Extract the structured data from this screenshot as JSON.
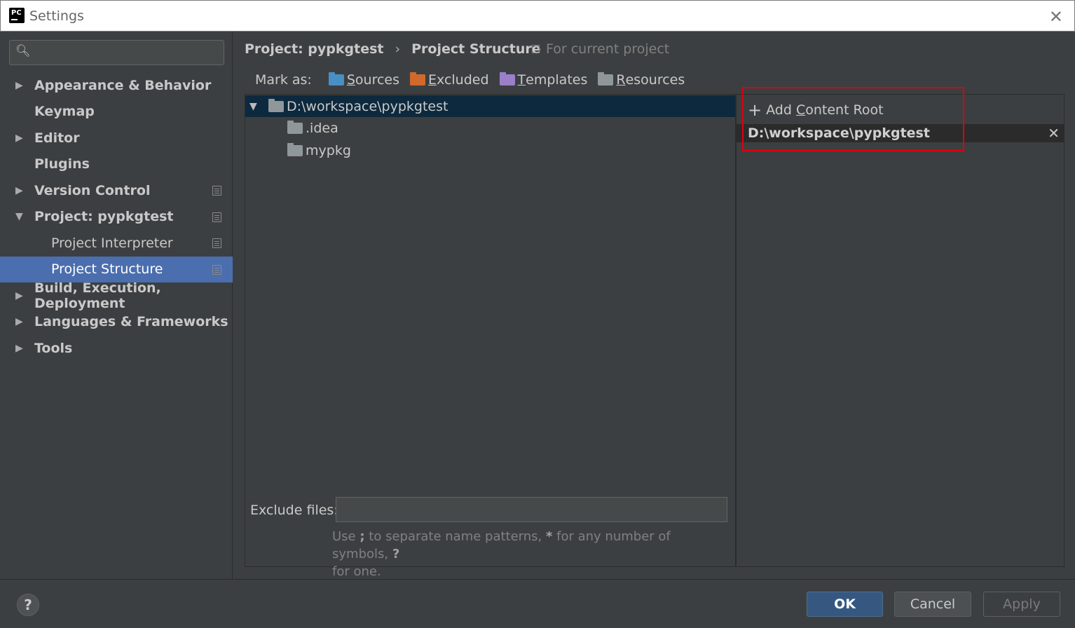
{
  "window": {
    "title": "Settings"
  },
  "sidebar": {
    "search": {
      "placeholder": ""
    },
    "items": [
      {
        "label": "Appearance & Behavior",
        "expandable": true
      },
      {
        "label": "Keymap",
        "expandable": false
      },
      {
        "label": "Editor",
        "expandable": true
      },
      {
        "label": "Plugins",
        "expandable": false
      },
      {
        "label": "Version Control",
        "expandable": true
      },
      {
        "label": "Project: pypkgtest",
        "expandable": true,
        "expanded": true
      },
      {
        "label": "Project Interpreter"
      },
      {
        "label": "Project Structure",
        "selected": true
      },
      {
        "label": "Build, Execution, Deployment",
        "expandable": true
      },
      {
        "label": "Languages & Frameworks",
        "expandable": true
      },
      {
        "label": "Tools",
        "expandable": true
      }
    ]
  },
  "main": {
    "breadcrumb": {
      "project": "Project: pypkgtest",
      "separator": "›",
      "page": "Project Structure"
    },
    "scope": "For current project",
    "mark_as": {
      "label": "Mark as:",
      "buttons": [
        {
          "mnemonic": "S",
          "rest": "ources",
          "color": "#4a8fc3"
        },
        {
          "mnemonic": "E",
          "rest": "xcluded",
          "color": "#d0692c"
        },
        {
          "mnemonic": "T",
          "rest": "emplates",
          "color": "#9b7fc9"
        },
        {
          "mnemonic": "R",
          "rest": "esources",
          "color": "#90979b"
        }
      ]
    },
    "tree": {
      "root": "D:\\workspace\\pypkgtest",
      "children": [
        ".idea",
        "mypkg"
      ]
    },
    "exclude": {
      "label": "Exclude files:",
      "value": "",
      "hint_parts": [
        "Use ",
        ";",
        " to separate name patterns, ",
        "*",
        " for any number of symbols, ",
        "?",
        " for one."
      ]
    },
    "content_root": {
      "add_label_pre": "Add ",
      "add_mnemonic": "C",
      "add_label_post": "ontent Root",
      "entry": "D:\\workspace\\pypkgtest",
      "remove": "✕"
    }
  },
  "footer": {
    "help": "?",
    "ok": "OK",
    "cancel": "Cancel",
    "apply": "Apply"
  },
  "colors": {
    "background": "#3c3f41",
    "selection": "#4b6eaf",
    "tree_selection": "#0d293e",
    "highlight": "#e0000d",
    "ok_button": "#365880"
  }
}
